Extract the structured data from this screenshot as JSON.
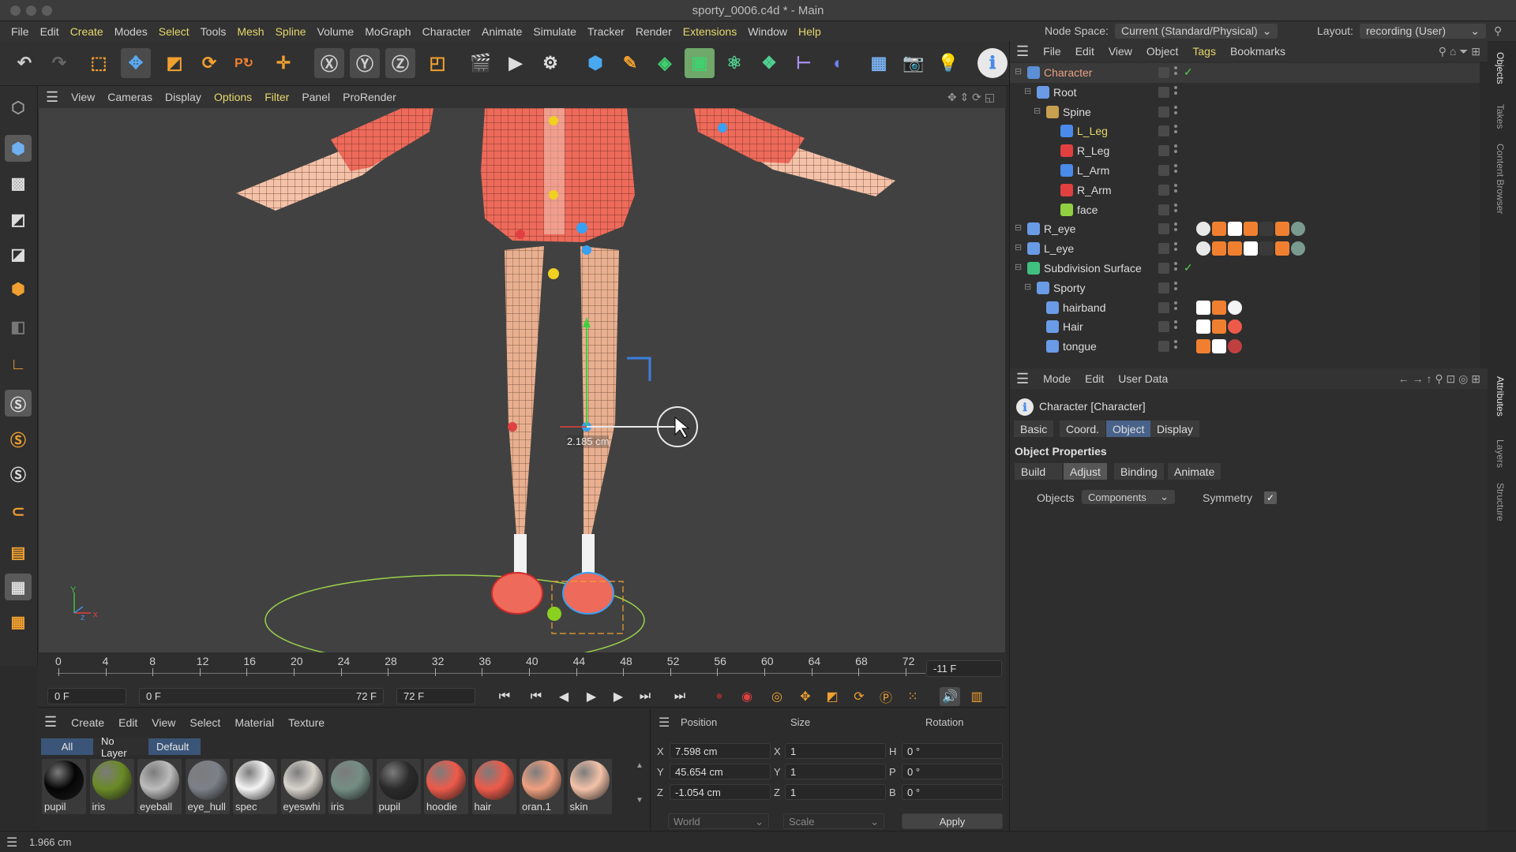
{
  "window": {
    "title": "sporty_0006.c4d * - Main"
  },
  "menu": [
    "File",
    "Edit",
    "Create",
    "Modes",
    "Select",
    "Tools",
    "Mesh",
    "Spline",
    "Volume",
    "MoGraph",
    "Character",
    "Animate",
    "Simulate",
    "Tracker",
    "Render",
    "Extensions",
    "Window",
    "Help"
  ],
  "node_space": {
    "label": "Node Space:",
    "value": "Current (Standard/Physical)"
  },
  "layout": {
    "label": "Layout:",
    "value": "recording (User)"
  },
  "viewport": {
    "menu": [
      "View",
      "Cameras",
      "Display",
      "Options",
      "Filter",
      "Panel",
      "ProRender"
    ],
    "measure": "2.185 cm",
    "axis_x": "x",
    "axis_y": "Y",
    "axis_z": "z"
  },
  "timeline": {
    "ticks": [
      "0",
      "4",
      "8",
      "12",
      "16",
      "20",
      "24",
      "28",
      "32",
      "36",
      "40",
      "44",
      "48",
      "52",
      "56",
      "60",
      "64",
      "68",
      "72"
    ],
    "current_frame": "-11 F"
  },
  "playback": {
    "start": "0 F",
    "range_start": "0 F",
    "range_end": "72 F",
    "end": "72 F"
  },
  "materials": {
    "menu": [
      "Create",
      "Edit",
      "View",
      "Select",
      "Material",
      "Texture"
    ],
    "filters": [
      "All",
      "No Layer",
      "Default"
    ],
    "items": [
      {
        "name": "pupil",
        "color": "#050505"
      },
      {
        "name": "iris",
        "color": "#6a8a25"
      },
      {
        "name": "eyeball",
        "color": "#bcbcbc"
      },
      {
        "name": "eye_hull",
        "color": "#7c8088"
      },
      {
        "name": "spec",
        "color": "#f4f4f4"
      },
      {
        "name": "eyeswhi",
        "color": "#d8d4cc"
      },
      {
        "name": "iris",
        "color": "#748e84"
      },
      {
        "name": "pupil",
        "color": "#2a2a2a"
      },
      {
        "name": "hoodie",
        "color": "#ee5a4a"
      },
      {
        "name": "hair",
        "color": "#ee5a4a"
      },
      {
        "name": "oran.1",
        "color": "#f0a080"
      },
      {
        "name": "skin",
        "color": "#f4c2a8"
      }
    ]
  },
  "coords": {
    "headers": {
      "position": "Position",
      "size": "Size",
      "rotation": "Rotation"
    },
    "rows": [
      {
        "axis": "X",
        "pos": "7.598 cm",
        "saxis": "X",
        "size": "1",
        "raxis": "H",
        "rot": "0 °"
      },
      {
        "axis": "Y",
        "pos": "45.654 cm",
        "saxis": "Y",
        "size": "1",
        "raxis": "P",
        "rot": "0 °"
      },
      {
        "axis": "Z",
        "pos": "-1.054 cm",
        "saxis": "Z",
        "size": "1",
        "raxis": "B",
        "rot": "0 °"
      }
    ],
    "space": "World",
    "mode": "Scale",
    "apply": "Apply"
  },
  "status": {
    "text": "1.966 cm"
  },
  "objects": {
    "menu": [
      "File",
      "Edit",
      "View",
      "Object",
      "Tags",
      "Bookmarks"
    ],
    "rows": [
      {
        "name": "Character",
        "color": "#e8a080",
        "icon": "#5b8fd6",
        "check": "✓"
      },
      {
        "name": "Root",
        "color": "#dddddd",
        "icon": "#6a9be6",
        "check": ""
      },
      {
        "name": "Spine",
        "color": "#dddddd",
        "icon": "#c8a050",
        "check": ""
      },
      {
        "name": "L_Leg",
        "color": "#e6d76c",
        "icon": "#4a8ae8",
        "check": ""
      },
      {
        "name": "R_Leg",
        "color": "#dddddd",
        "icon": "#e04040",
        "check": ""
      },
      {
        "name": "L_Arm",
        "color": "#dddddd",
        "icon": "#4a8ae8",
        "check": ""
      },
      {
        "name": "R_Arm",
        "color": "#dddddd",
        "icon": "#e04040",
        "check": ""
      },
      {
        "name": "face",
        "color": "#dddddd",
        "icon": "#90d040",
        "check": ""
      },
      {
        "name": "R_eye",
        "color": "#dddddd",
        "icon": "#6a9be6",
        "check": ""
      },
      {
        "name": "L_eye",
        "color": "#dddddd",
        "icon": "#6a9be6",
        "check": ""
      },
      {
        "name": "Subdivision Surface",
        "color": "#dddddd",
        "icon": "#40c080",
        "check": "✓"
      },
      {
        "name": "Sporty",
        "color": "#dddddd",
        "icon": "#6a9be6",
        "check": ""
      },
      {
        "name": "hairband",
        "color": "#dddddd",
        "icon": "#6a9be6",
        "check": ""
      },
      {
        "name": "Hair",
        "color": "#dddddd",
        "icon": "#6a9be6",
        "check": ""
      },
      {
        "name": "tongue",
        "color": "#dddddd",
        "icon": "#6a9be6",
        "check": ""
      }
    ]
  },
  "attributes": {
    "menu": [
      "Mode",
      "Edit",
      "User Data"
    ],
    "title": "Character [Character]",
    "tabs": [
      "Basic",
      "Coord.",
      "Object",
      "Display"
    ],
    "section": "Object Properties",
    "subtabs": [
      "Build",
      "Adjust",
      "Binding",
      "Animate"
    ],
    "objects_label": "Objects",
    "objects_value": "Components",
    "symmetry_label": "Symmetry",
    "symmetry_check": "✓"
  },
  "side_tabs": [
    "Objects",
    "Takes",
    "Content Browser",
    "Attributes",
    "Layers",
    "Structure"
  ]
}
